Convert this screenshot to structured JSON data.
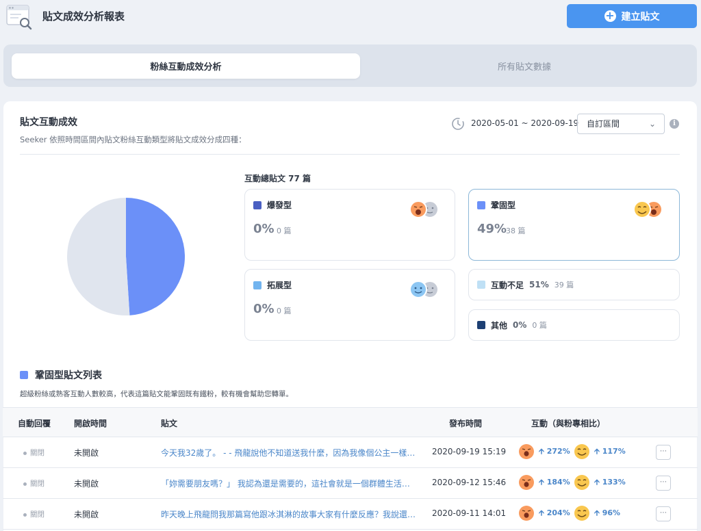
{
  "header": {
    "title": "貼文成效分析報表",
    "create_button": "建立貼文"
  },
  "tabs": [
    {
      "label": "粉絲互動成效分析",
      "active": true
    },
    {
      "label": "所有貼文數據",
      "active": false
    }
  ],
  "section": {
    "title": "貼文互動成效",
    "desc": "Seeker 依照時間區間內貼文粉絲互動類型將貼文成效分成四種：",
    "date_range": "2020-05-01 ~ 2020-09-19",
    "range_select": "自訂區間",
    "total_posts": "互動總貼文 77 篇"
  },
  "pie": {
    "slices": [
      {
        "name": "鞏固型",
        "value": 49,
        "color": "#6b90f8"
      },
      {
        "name": "互動不足",
        "value": 51,
        "color": "#e0e5ee"
      }
    ]
  },
  "types": {
    "burst": {
      "name": "爆發型",
      "pct": "0%",
      "count": "0 篇",
      "color": "#4a5fc2"
    },
    "consolidate": {
      "name": "鞏固型",
      "pct": "49%",
      "count": "38 篇",
      "color": "#6b90f8"
    },
    "expand": {
      "name": "拓展型",
      "pct": "0%",
      "count": "0 篇",
      "color": "#72b4ef"
    },
    "insufficient": {
      "name": "互動不足",
      "pct": "51%",
      "count": "39 篇",
      "color": "#bfe0f5"
    },
    "other": {
      "name": "其他",
      "pct": "0%",
      "count": "0 篇",
      "color": "#1d3f73"
    }
  },
  "list": {
    "title": "鞏固型貼文列表",
    "desc": "超級粉絲或熟客互動人數較高，代表這篇貼文能鞏固既有鐵粉，較有機會幫助您轉單。",
    "columns": [
      "自動回覆",
      "開啟時間",
      "貼文",
      "發布時間",
      "互動（與粉專相比）"
    ],
    "rows": [
      {
        "auto": "關閉",
        "open": "未開啟",
        "post": "今天我32歲了。 - - 飛龍說他不知道送我什麼，因為我像個公主一樣什麼都有了",
        "time": "2020-09-19 15:19",
        "m1": "272%",
        "m2": "117%"
      },
      {
        "auto": "關閉",
        "open": "未開啟",
        "post": "「妳需要朋友嗎？」 我認為還是需要的，這社會就是一個群體生活的地方",
        "time": "2020-09-12 15:46",
        "m1": "184%",
        "m2": "133%"
      },
      {
        "auto": "關閉",
        "open": "未開啟",
        "post": "昨天晚上飛龍問我那篇寫他跟冰淇淋的故事大家有什麼反應？我說還不錯",
        "time": "2020-09-11 14:01",
        "m1": "204%",
        "m2": "96%"
      }
    ]
  }
}
